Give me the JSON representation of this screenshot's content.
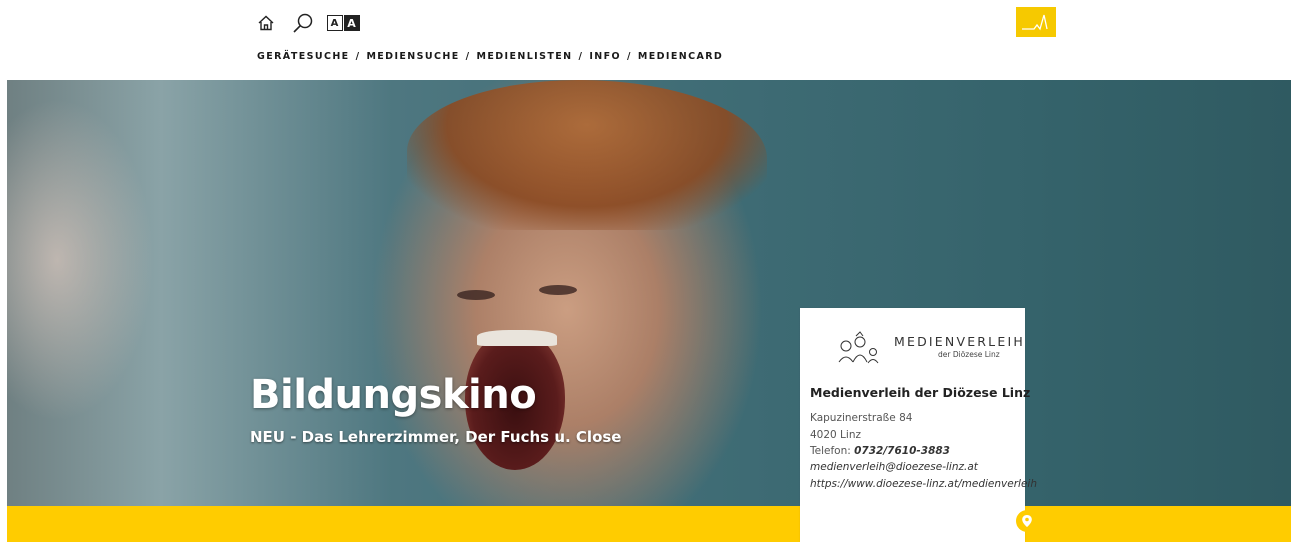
{
  "header": {
    "icons": {
      "home": "home-icon",
      "search": "search-icon",
      "font_size": "font-size-icon",
      "logo": "pulse-logo-icon"
    },
    "font_size_label_small": "A",
    "font_size_label_large": "A",
    "nav": [
      {
        "label": "GERÄTESUCHE"
      },
      {
        "label": "MEDIENSUCHE"
      },
      {
        "label": "MEDIENLISTEN"
      },
      {
        "label": "INFO"
      },
      {
        "label": "MEDIENCARD"
      }
    ],
    "nav_separator": "/"
  },
  "hero": {
    "title": "Bildungskino",
    "subtitle": "NEU - Das Lehrerzimmer, Der Fuchs u. Close"
  },
  "card": {
    "brand": "MEDIENVERLEIH",
    "brand_sub": "der Diözese Linz",
    "name": "Medienverleih der Diözese Linz",
    "street": "Kapuzinerstraße 84",
    "city": "4020 Linz",
    "phone_label": "Telefon: ",
    "phone": "0732/7610-3883",
    "email": "medienverleih@dioezese-linz.at",
    "website": "https://www.dioezese-linz.at/medienverleih",
    "map_icon": "map-pin-icon"
  },
  "colors": {
    "accent_yellow": "#ffcc00",
    "logo_yellow": "#f6c900",
    "text_dark": "#1a1a1a"
  }
}
